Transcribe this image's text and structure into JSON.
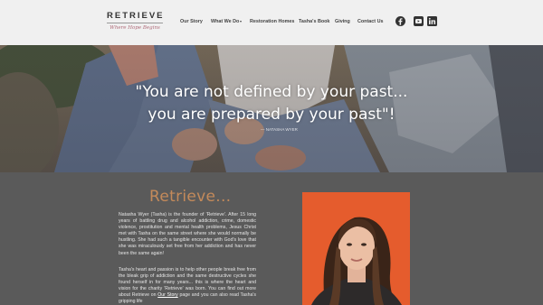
{
  "brand": {
    "name": "RETRIEVE",
    "tagline": "Where Hope Begins"
  },
  "nav": {
    "items": [
      {
        "label": "Our Story"
      },
      {
        "label": "What We Do"
      },
      {
        "label": "Restoration Homes"
      },
      {
        "label": "Tasha's Book"
      },
      {
        "label": "Giving"
      },
      {
        "label": "Contact Us"
      }
    ]
  },
  "social": {
    "icons": [
      "facebook-icon",
      "youtube-icon",
      "linkedin-icon"
    ]
  },
  "hero": {
    "quote_line1": "\"You are not defined by your past...",
    "quote_line2": "you are prepared by your past\"!",
    "attribution": "— NATASHA WYER"
  },
  "about": {
    "title": "Retrieve...",
    "paragraph1": "Natasha Wyer (Tasha) is the founder of 'Retrieve'. After 15 long years of battling drug and alcohol addiction, crime, domestic violence, prostitution and mental health problems, Jesus Christ met with Tasha on the same street where she would normally be hustling. She had such a tangible encounter with God's love that she was miraculously set free from her addiction and has never been the same again!",
    "paragraph2_before_link": "Tasha's heart and passion is to help other people break free from the bleak grip of addiction and the same destructive cycles she found herself in for many years... this is where the heart and vision for the charity 'Retrieve' was born. You can find out more about Retrieve on ",
    "paragraph2_link": "Our Story",
    "paragraph2_after_link": " page and you can also read Tasha's gripping life"
  },
  "colors": {
    "header_bg": "#f0f0f0",
    "content_bg": "#5a5a5a",
    "title_accent": "#c48a5a",
    "photo_bg": "#e2572b"
  }
}
